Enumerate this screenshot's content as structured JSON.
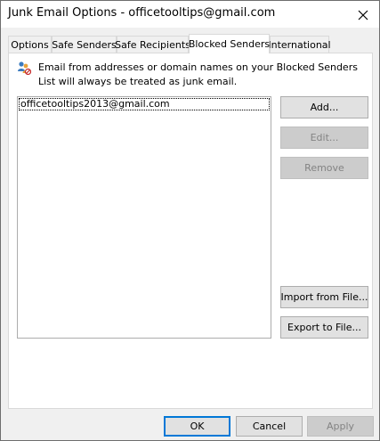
{
  "window": {
    "title": "Junk Email Options - officetooltips@gmail.com"
  },
  "tabs": [
    {
      "label": "Options"
    },
    {
      "label": "Safe Senders"
    },
    {
      "label": "Safe Recipients"
    },
    {
      "label": "Blocked Senders",
      "active": true
    },
    {
      "label": "International"
    }
  ],
  "panel": {
    "info_text": "Email from addresses or domain names on your Blocked Senders List will always be treated as junk email.",
    "info_icon": "people-blocked-icon",
    "list_items": [
      "officetooltips2013@gmail.com"
    ],
    "buttons": {
      "add": "Add...",
      "edit": "Edit...",
      "remove": "Remove",
      "import": "Import from File...",
      "export": "Export to File..."
    }
  },
  "footer": {
    "ok": "OK",
    "cancel": "Cancel",
    "apply": "Apply"
  },
  "colors": {
    "dialog_bg": "#f0f0f0",
    "default_button_border": "#0078d7",
    "disabled_text": "#838383"
  }
}
